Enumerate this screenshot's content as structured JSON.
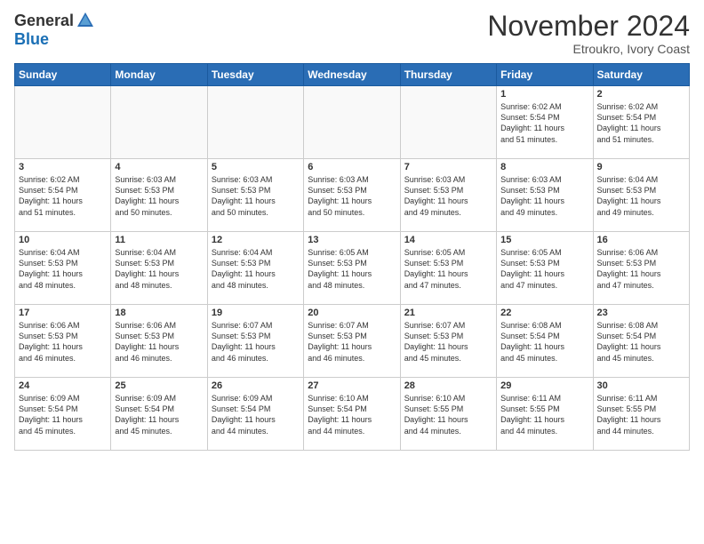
{
  "header": {
    "logo_general": "General",
    "logo_blue": "Blue",
    "month_title": "November 2024",
    "location": "Etroukro, Ivory Coast"
  },
  "weekdays": [
    "Sunday",
    "Monday",
    "Tuesday",
    "Wednesday",
    "Thursday",
    "Friday",
    "Saturday"
  ],
  "weeks": [
    [
      {
        "day": "",
        "info": ""
      },
      {
        "day": "",
        "info": ""
      },
      {
        "day": "",
        "info": ""
      },
      {
        "day": "",
        "info": ""
      },
      {
        "day": "",
        "info": ""
      },
      {
        "day": "1",
        "info": "Sunrise: 6:02 AM\nSunset: 5:54 PM\nDaylight: 11 hours\nand 51 minutes."
      },
      {
        "day": "2",
        "info": "Sunrise: 6:02 AM\nSunset: 5:54 PM\nDaylight: 11 hours\nand 51 minutes."
      }
    ],
    [
      {
        "day": "3",
        "info": "Sunrise: 6:02 AM\nSunset: 5:54 PM\nDaylight: 11 hours\nand 51 minutes."
      },
      {
        "day": "4",
        "info": "Sunrise: 6:03 AM\nSunset: 5:53 PM\nDaylight: 11 hours\nand 50 minutes."
      },
      {
        "day": "5",
        "info": "Sunrise: 6:03 AM\nSunset: 5:53 PM\nDaylight: 11 hours\nand 50 minutes."
      },
      {
        "day": "6",
        "info": "Sunrise: 6:03 AM\nSunset: 5:53 PM\nDaylight: 11 hours\nand 50 minutes."
      },
      {
        "day": "7",
        "info": "Sunrise: 6:03 AM\nSunset: 5:53 PM\nDaylight: 11 hours\nand 49 minutes."
      },
      {
        "day": "8",
        "info": "Sunrise: 6:03 AM\nSunset: 5:53 PM\nDaylight: 11 hours\nand 49 minutes."
      },
      {
        "day": "9",
        "info": "Sunrise: 6:04 AM\nSunset: 5:53 PM\nDaylight: 11 hours\nand 49 minutes."
      }
    ],
    [
      {
        "day": "10",
        "info": "Sunrise: 6:04 AM\nSunset: 5:53 PM\nDaylight: 11 hours\nand 48 minutes."
      },
      {
        "day": "11",
        "info": "Sunrise: 6:04 AM\nSunset: 5:53 PM\nDaylight: 11 hours\nand 48 minutes."
      },
      {
        "day": "12",
        "info": "Sunrise: 6:04 AM\nSunset: 5:53 PM\nDaylight: 11 hours\nand 48 minutes."
      },
      {
        "day": "13",
        "info": "Sunrise: 6:05 AM\nSunset: 5:53 PM\nDaylight: 11 hours\nand 48 minutes."
      },
      {
        "day": "14",
        "info": "Sunrise: 6:05 AM\nSunset: 5:53 PM\nDaylight: 11 hours\nand 47 minutes."
      },
      {
        "day": "15",
        "info": "Sunrise: 6:05 AM\nSunset: 5:53 PM\nDaylight: 11 hours\nand 47 minutes."
      },
      {
        "day": "16",
        "info": "Sunrise: 6:06 AM\nSunset: 5:53 PM\nDaylight: 11 hours\nand 47 minutes."
      }
    ],
    [
      {
        "day": "17",
        "info": "Sunrise: 6:06 AM\nSunset: 5:53 PM\nDaylight: 11 hours\nand 46 minutes."
      },
      {
        "day": "18",
        "info": "Sunrise: 6:06 AM\nSunset: 5:53 PM\nDaylight: 11 hours\nand 46 minutes."
      },
      {
        "day": "19",
        "info": "Sunrise: 6:07 AM\nSunset: 5:53 PM\nDaylight: 11 hours\nand 46 minutes."
      },
      {
        "day": "20",
        "info": "Sunrise: 6:07 AM\nSunset: 5:53 PM\nDaylight: 11 hours\nand 46 minutes."
      },
      {
        "day": "21",
        "info": "Sunrise: 6:07 AM\nSunset: 5:53 PM\nDaylight: 11 hours\nand 45 minutes."
      },
      {
        "day": "22",
        "info": "Sunrise: 6:08 AM\nSunset: 5:54 PM\nDaylight: 11 hours\nand 45 minutes."
      },
      {
        "day": "23",
        "info": "Sunrise: 6:08 AM\nSunset: 5:54 PM\nDaylight: 11 hours\nand 45 minutes."
      }
    ],
    [
      {
        "day": "24",
        "info": "Sunrise: 6:09 AM\nSunset: 5:54 PM\nDaylight: 11 hours\nand 45 minutes."
      },
      {
        "day": "25",
        "info": "Sunrise: 6:09 AM\nSunset: 5:54 PM\nDaylight: 11 hours\nand 45 minutes."
      },
      {
        "day": "26",
        "info": "Sunrise: 6:09 AM\nSunset: 5:54 PM\nDaylight: 11 hours\nand 44 minutes."
      },
      {
        "day": "27",
        "info": "Sunrise: 6:10 AM\nSunset: 5:54 PM\nDaylight: 11 hours\nand 44 minutes."
      },
      {
        "day": "28",
        "info": "Sunrise: 6:10 AM\nSunset: 5:55 PM\nDaylight: 11 hours\nand 44 minutes."
      },
      {
        "day": "29",
        "info": "Sunrise: 6:11 AM\nSunset: 5:55 PM\nDaylight: 11 hours\nand 44 minutes."
      },
      {
        "day": "30",
        "info": "Sunrise: 6:11 AM\nSunset: 5:55 PM\nDaylight: 11 hours\nand 44 minutes."
      }
    ]
  ]
}
